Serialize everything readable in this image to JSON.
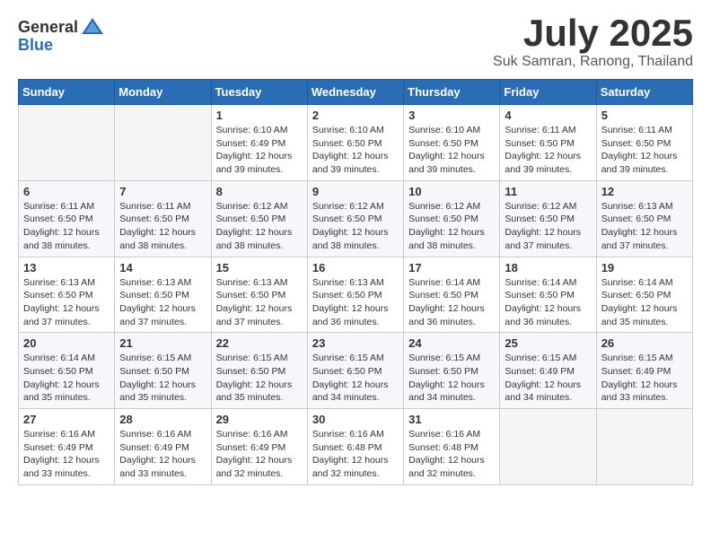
{
  "header": {
    "logo_general": "General",
    "logo_blue": "Blue",
    "month": "July 2025",
    "location": "Suk Samran, Ranong, Thailand"
  },
  "days_of_week": [
    "Sunday",
    "Monday",
    "Tuesday",
    "Wednesday",
    "Thursday",
    "Friday",
    "Saturday"
  ],
  "weeks": [
    [
      {
        "day": "",
        "info": ""
      },
      {
        "day": "",
        "info": ""
      },
      {
        "day": "1",
        "info": "Sunrise: 6:10 AM\nSunset: 6:49 PM\nDaylight: 12 hours and 39 minutes."
      },
      {
        "day": "2",
        "info": "Sunrise: 6:10 AM\nSunset: 6:50 PM\nDaylight: 12 hours and 39 minutes."
      },
      {
        "day": "3",
        "info": "Sunrise: 6:10 AM\nSunset: 6:50 PM\nDaylight: 12 hours and 39 minutes."
      },
      {
        "day": "4",
        "info": "Sunrise: 6:11 AM\nSunset: 6:50 PM\nDaylight: 12 hours and 39 minutes."
      },
      {
        "day": "5",
        "info": "Sunrise: 6:11 AM\nSunset: 6:50 PM\nDaylight: 12 hours and 39 minutes."
      }
    ],
    [
      {
        "day": "6",
        "info": "Sunrise: 6:11 AM\nSunset: 6:50 PM\nDaylight: 12 hours and 38 minutes."
      },
      {
        "day": "7",
        "info": "Sunrise: 6:11 AM\nSunset: 6:50 PM\nDaylight: 12 hours and 38 minutes."
      },
      {
        "day": "8",
        "info": "Sunrise: 6:12 AM\nSunset: 6:50 PM\nDaylight: 12 hours and 38 minutes."
      },
      {
        "day": "9",
        "info": "Sunrise: 6:12 AM\nSunset: 6:50 PM\nDaylight: 12 hours and 38 minutes."
      },
      {
        "day": "10",
        "info": "Sunrise: 6:12 AM\nSunset: 6:50 PM\nDaylight: 12 hours and 38 minutes."
      },
      {
        "day": "11",
        "info": "Sunrise: 6:12 AM\nSunset: 6:50 PM\nDaylight: 12 hours and 37 minutes."
      },
      {
        "day": "12",
        "info": "Sunrise: 6:13 AM\nSunset: 6:50 PM\nDaylight: 12 hours and 37 minutes."
      }
    ],
    [
      {
        "day": "13",
        "info": "Sunrise: 6:13 AM\nSunset: 6:50 PM\nDaylight: 12 hours and 37 minutes."
      },
      {
        "day": "14",
        "info": "Sunrise: 6:13 AM\nSunset: 6:50 PM\nDaylight: 12 hours and 37 minutes."
      },
      {
        "day": "15",
        "info": "Sunrise: 6:13 AM\nSunset: 6:50 PM\nDaylight: 12 hours and 37 minutes."
      },
      {
        "day": "16",
        "info": "Sunrise: 6:13 AM\nSunset: 6:50 PM\nDaylight: 12 hours and 36 minutes."
      },
      {
        "day": "17",
        "info": "Sunrise: 6:14 AM\nSunset: 6:50 PM\nDaylight: 12 hours and 36 minutes."
      },
      {
        "day": "18",
        "info": "Sunrise: 6:14 AM\nSunset: 6:50 PM\nDaylight: 12 hours and 36 minutes."
      },
      {
        "day": "19",
        "info": "Sunrise: 6:14 AM\nSunset: 6:50 PM\nDaylight: 12 hours and 35 minutes."
      }
    ],
    [
      {
        "day": "20",
        "info": "Sunrise: 6:14 AM\nSunset: 6:50 PM\nDaylight: 12 hours and 35 minutes."
      },
      {
        "day": "21",
        "info": "Sunrise: 6:15 AM\nSunset: 6:50 PM\nDaylight: 12 hours and 35 minutes."
      },
      {
        "day": "22",
        "info": "Sunrise: 6:15 AM\nSunset: 6:50 PM\nDaylight: 12 hours and 35 minutes."
      },
      {
        "day": "23",
        "info": "Sunrise: 6:15 AM\nSunset: 6:50 PM\nDaylight: 12 hours and 34 minutes."
      },
      {
        "day": "24",
        "info": "Sunrise: 6:15 AM\nSunset: 6:50 PM\nDaylight: 12 hours and 34 minutes."
      },
      {
        "day": "25",
        "info": "Sunrise: 6:15 AM\nSunset: 6:49 PM\nDaylight: 12 hours and 34 minutes."
      },
      {
        "day": "26",
        "info": "Sunrise: 6:15 AM\nSunset: 6:49 PM\nDaylight: 12 hours and 33 minutes."
      }
    ],
    [
      {
        "day": "27",
        "info": "Sunrise: 6:16 AM\nSunset: 6:49 PM\nDaylight: 12 hours and 33 minutes."
      },
      {
        "day": "28",
        "info": "Sunrise: 6:16 AM\nSunset: 6:49 PM\nDaylight: 12 hours and 33 minutes."
      },
      {
        "day": "29",
        "info": "Sunrise: 6:16 AM\nSunset: 6:49 PM\nDaylight: 12 hours and 32 minutes."
      },
      {
        "day": "30",
        "info": "Sunrise: 6:16 AM\nSunset: 6:48 PM\nDaylight: 12 hours and 32 minutes."
      },
      {
        "day": "31",
        "info": "Sunrise: 6:16 AM\nSunset: 6:48 PM\nDaylight: 12 hours and 32 minutes."
      },
      {
        "day": "",
        "info": ""
      },
      {
        "day": "",
        "info": ""
      }
    ]
  ]
}
